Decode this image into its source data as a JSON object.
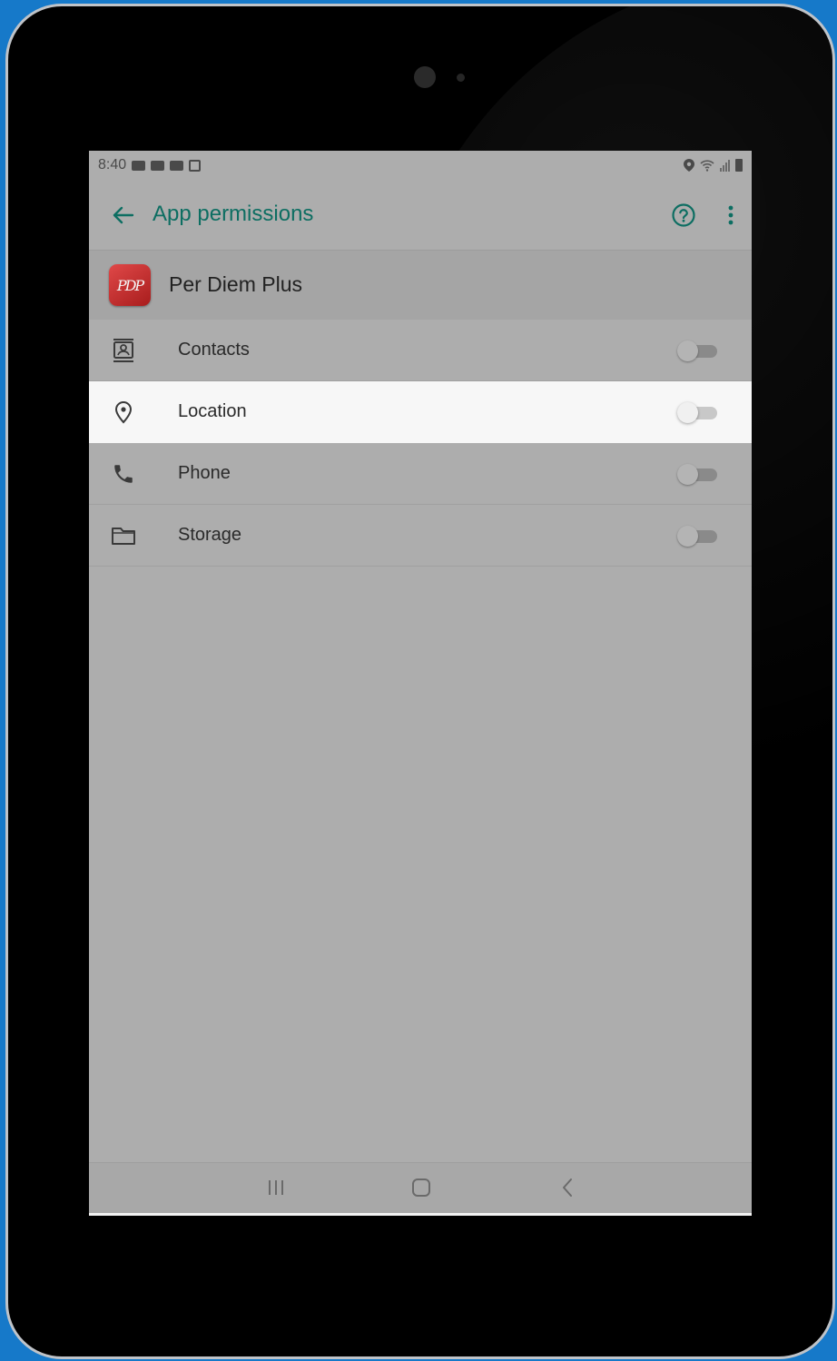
{
  "status_bar": {
    "time": "8:40"
  },
  "app_bar": {
    "title": "App permissions",
    "back_icon": "arrow-left-icon",
    "help_icon": "help-circle-icon",
    "more_icon": "more-vertical-icon"
  },
  "app": {
    "name": "Per Diem Plus",
    "logo_text": "PDP"
  },
  "permissions": [
    {
      "label": "Contacts",
      "icon": "contacts-icon",
      "enabled": false
    },
    {
      "label": "Location",
      "icon": "location-pin-icon",
      "enabled": false,
      "highlighted": true
    },
    {
      "label": "Phone",
      "icon": "phone-icon",
      "enabled": false
    },
    {
      "label": "Storage",
      "icon": "folder-icon",
      "enabled": false
    }
  ],
  "nav_bar": {
    "recents_icon": "recents-icon",
    "home_icon": "home-icon",
    "back_icon": "nav-back-icon"
  },
  "colors": {
    "accent": "#0d6e62",
    "screen_dim": "#adadad",
    "highlight_row": "#f7f7f7",
    "background": "#1679c9"
  }
}
